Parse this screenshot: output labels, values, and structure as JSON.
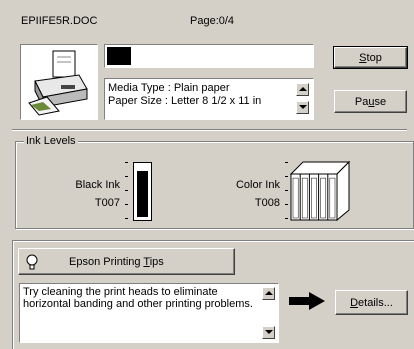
{
  "header": {
    "filename": "EPIIFE5R.DOC",
    "page_status": "Page:0/4"
  },
  "progress": {
    "fraction": 0.12
  },
  "media_info": {
    "line1": "Media Type : Plain paper",
    "line2": "Paper Size : Letter 8 1/2 x 11 in"
  },
  "buttons": {
    "stop_prefix": "",
    "stop_accel": "S",
    "stop_suffix": "top",
    "pause_prefix": "Pa",
    "pause_accel": "u",
    "pause_suffix": "se",
    "tips_prefix": "Epson Printing ",
    "tips_accel": "T",
    "tips_suffix": "ips",
    "details_prefix": "",
    "details_accel": "D",
    "details_suffix": "etails..."
  },
  "ink_levels": {
    "group_label": "Ink Levels",
    "black": {
      "name": "Black Ink",
      "code": "T007",
      "level": 0.9
    },
    "color": {
      "name": "Color Ink",
      "code": "T008",
      "levels": [
        0.95,
        0.95,
        0.95,
        0.95,
        0.95
      ]
    }
  },
  "tip": {
    "text": "Try cleaning the print heads to eliminate horizontal banding and other printing problems."
  },
  "icons": {
    "printer": "printer-icon",
    "lightbulb": "lightbulb-icon",
    "arrow": "right-arrow-icon"
  }
}
